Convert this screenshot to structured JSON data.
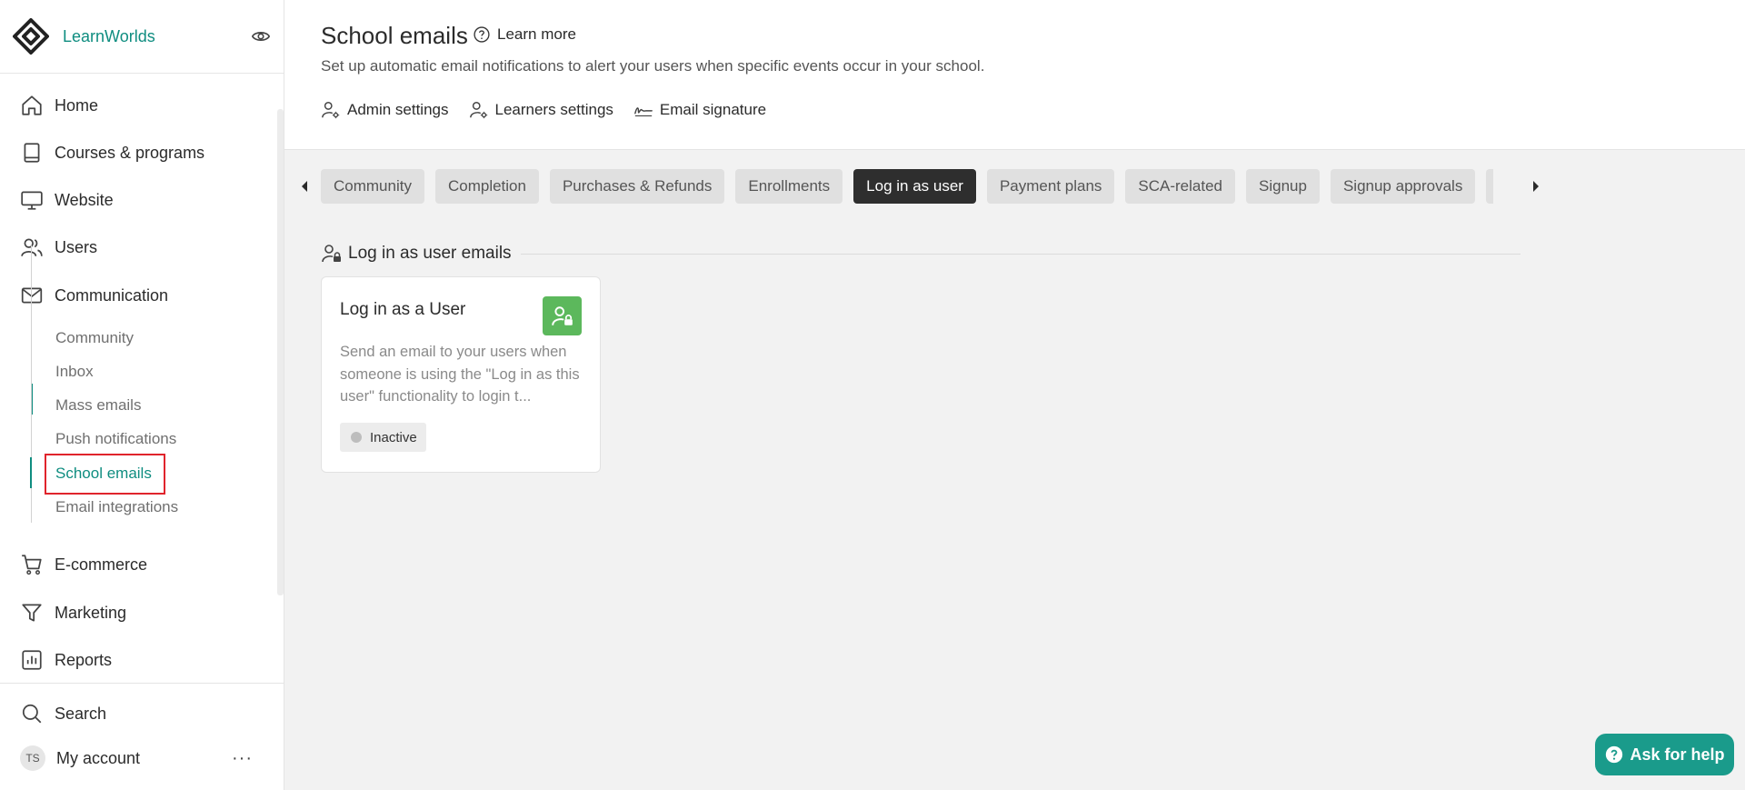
{
  "brand": {
    "name": "LearnWorlds"
  },
  "nav": {
    "home": "Home",
    "courses": "Courses & programs",
    "website": "Website",
    "users": "Users",
    "communication": "Communication",
    "sub": [
      "Community",
      "Inbox",
      "Mass emails",
      "Push notifications",
      "School emails",
      "Email integrations"
    ],
    "ecommerce": "E-commerce",
    "marketing": "Marketing",
    "reports": "Reports",
    "search": "Search",
    "account": "My account",
    "avatar_initials": "TS",
    "more": "···"
  },
  "header": {
    "title": "School emails",
    "learn_more": "Learn more",
    "subtitle": "Set up automatic email notifications to alert your users when specific events occur in your school.",
    "links": [
      "Admin settings",
      "Learners settings",
      "Email signature"
    ]
  },
  "tabs": [
    {
      "label": "Community",
      "active": false
    },
    {
      "label": "Completion",
      "active": false
    },
    {
      "label": "Purchases & Refunds",
      "active": false
    },
    {
      "label": "Enrollments",
      "active": false
    },
    {
      "label": "Log in as user",
      "active": true
    },
    {
      "label": "Payment plans",
      "active": false
    },
    {
      "label": "SCA-related",
      "active": false
    },
    {
      "label": "Signup",
      "active": false
    },
    {
      "label": "Signup approvals",
      "active": false
    }
  ],
  "section": {
    "title": "Log in as user emails"
  },
  "card": {
    "title": "Log in as a User",
    "description": "Send an email to your users when someone is using the \"Log in as this user\" functionality to login t...",
    "status": "Inactive"
  },
  "help": {
    "label": "Ask for help"
  },
  "colors": {
    "accent": "#0f8d80",
    "active_tab": "#2e2e2e",
    "badge_green": "#5cb85c",
    "help_bg": "#1a9b8b",
    "highlight": "#e0242c"
  }
}
